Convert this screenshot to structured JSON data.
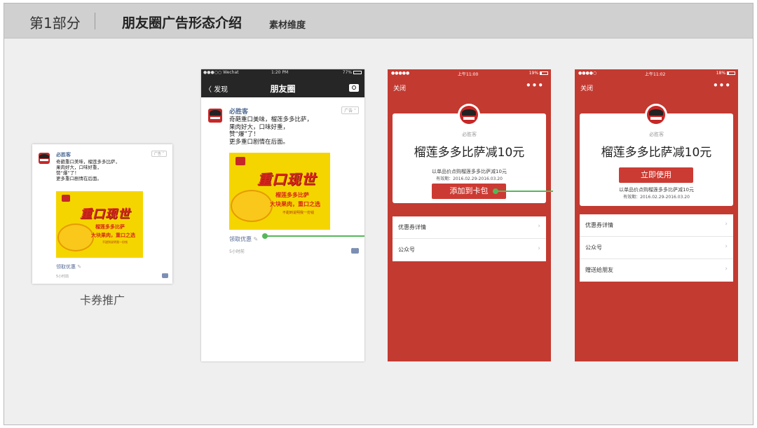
{
  "header": {
    "part": "第1部分",
    "title": "朋友圈广告形态介绍",
    "subtitle": "素材维度"
  },
  "caption": "卡券推广",
  "ad": {
    "brand": "必胜客",
    "tag": "广告 ˅",
    "lines": [
      "奇葩重口美味，榴莲多多比萨，",
      "果肉好大，口味好重，",
      "赞“爆”了！",
      "更多重口剧情在后面。"
    ],
    "poster": {
      "headline": "重口现世",
      "line1": "榴莲多多比萨",
      "line2": "大块果肉，重口之选",
      "small": "不甜到说明我一份钱"
    },
    "link": "领取优惠",
    "time": "5小时前"
  },
  "phone1": {
    "status": {
      "carrier": "●●●○○ Wechat",
      "time": "1:20 PM",
      "battery": "77%"
    },
    "back": "〈 发现",
    "title": "朋友圈"
  },
  "phone2": {
    "status": {
      "signal": "●●●●●",
      "time": "上午11:00",
      "battery": "19%"
    },
    "close": "关闭",
    "more": "•••",
    "brand": "必胜客",
    "title": "榴莲多多比萨减10元",
    "desc": "以单品价点购榴莲多多比萨减10元",
    "period": "有效期：2016.02.29-2016.03.20",
    "button": "添加到卡包",
    "rows": [
      "优惠券详情",
      "公众号"
    ]
  },
  "phone3": {
    "status": {
      "signal": "●●●●○",
      "time": "上午11:02",
      "battery": "18%"
    },
    "close": "关闭",
    "more": "•••",
    "brand": "必胜客",
    "title": "榴莲多多比萨减10元",
    "button": "立即使用",
    "desc": "以单品价点购榴莲多多比萨减10元",
    "period": "有效期：2016.02.29-2016.03.20",
    "rows": [
      "优惠券详情",
      "公众号",
      "赠送给朋友"
    ]
  },
  "icons": {
    "chevron": "›",
    "pencil": "✎"
  },
  "colors": {
    "wechat_red": "#c33a31",
    "connector_green": "#55b858",
    "link_blue": "#576b95",
    "poster_yellow": "#f5d500"
  }
}
